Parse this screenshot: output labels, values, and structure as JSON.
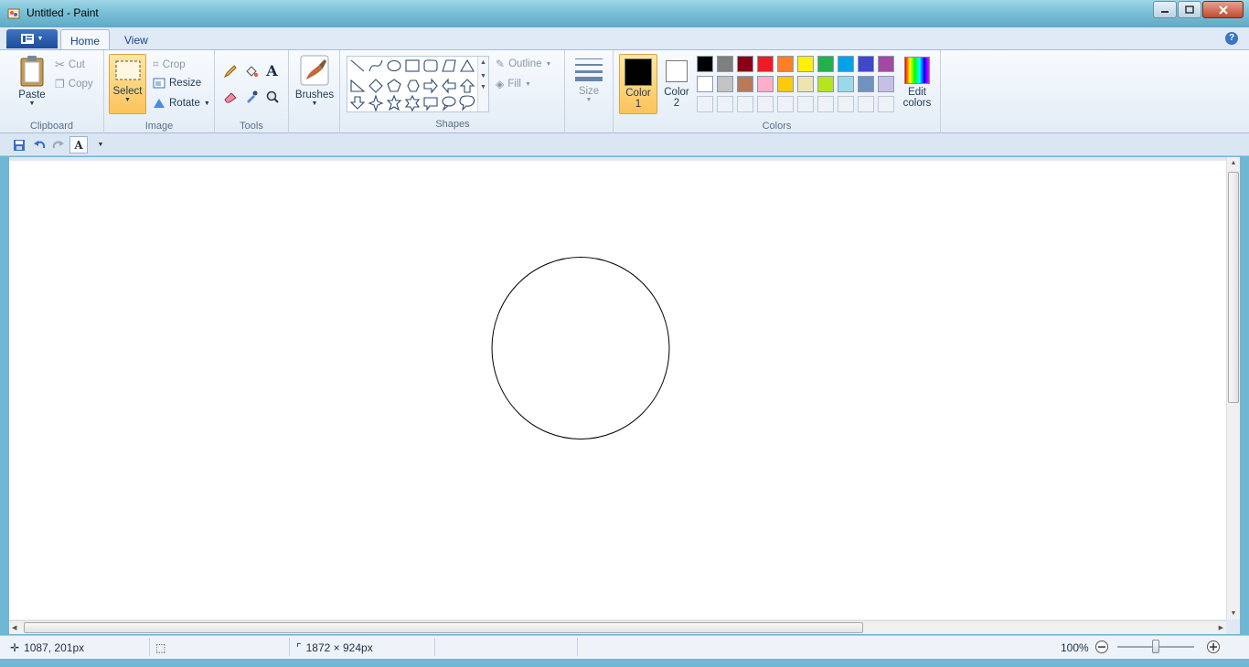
{
  "window": {
    "title": "Untitled - Paint"
  },
  "tabs": [
    {
      "label": "Home"
    },
    {
      "label": "View"
    }
  ],
  "help_label": "?",
  "clipboard": {
    "paste": "Paste",
    "cut": "Cut",
    "copy": "Copy",
    "group": "Clipboard"
  },
  "image": {
    "select": "Select",
    "crop": "Crop",
    "resize": "Resize",
    "rotate": "Rotate",
    "group": "Image"
  },
  "tools": {
    "group": "Tools"
  },
  "brushes": {
    "label": "Brushes"
  },
  "shapes": {
    "outline": "Outline",
    "fill": "Fill",
    "group": "Shapes"
  },
  "size": {
    "label": "Size"
  },
  "colors": {
    "color1_line1": "Color",
    "color1_line2": "1",
    "color2_line1": "Color",
    "color2_line2": "2",
    "edit_line1": "Edit",
    "edit_line2": "colors",
    "group": "Colors",
    "color1_value": "#000000",
    "color2_value": "#ffffff",
    "palette_row1": [
      "#000000",
      "#7f7f7f",
      "#880015",
      "#ed1c24",
      "#ff7f27",
      "#fff200",
      "#22b14c",
      "#00a2e8",
      "#3f48cc",
      "#a349a4"
    ],
    "palette_row2": [
      "#ffffff",
      "#c3c3c3",
      "#b97a57",
      "#ffaec9",
      "#ffc90e",
      "#efe4b0",
      "#b5e61d",
      "#99d9ea",
      "#7092be",
      "#c8bfe7"
    ]
  },
  "status": {
    "cursor_pos": "1087, 201px",
    "image_size": "1872 × 924px",
    "zoom": "100%"
  }
}
